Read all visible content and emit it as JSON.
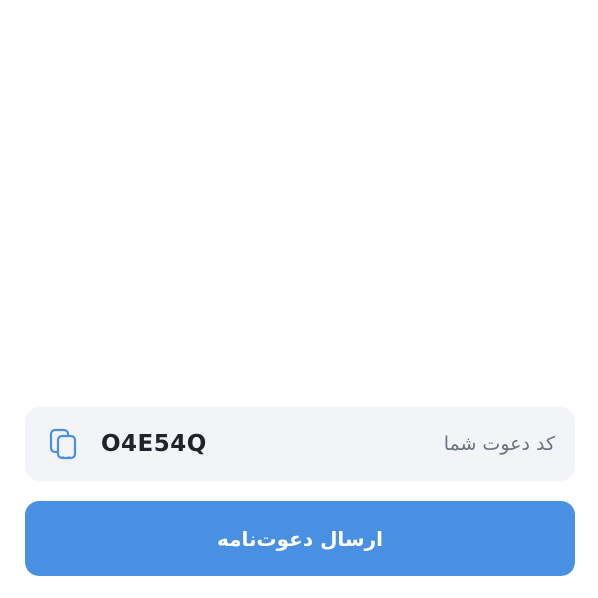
{
  "invite": {
    "label": "کد دعوت شما",
    "code": "O4E54Q",
    "copy_icon": "copy-icon"
  },
  "send_button": {
    "label": "ارسال دعوت‌نامه",
    "color": "#4a90e2"
  },
  "colors": {
    "card_background": "#f2f4f7",
    "code_text": "#20232b",
    "label_text": "#6b7280",
    "icon": "#4a90e2"
  }
}
